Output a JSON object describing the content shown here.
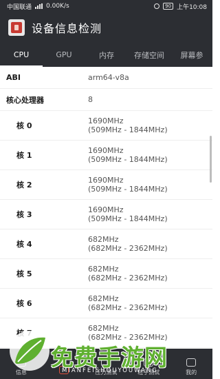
{
  "status_bar": {
    "carrier": "中国联通",
    "network_type": "4G",
    "speed": "0.00K/s",
    "battery": "90",
    "time": "上午10:08"
  },
  "app_bar": {
    "title": "设备信息检测"
  },
  "tabs": [
    {
      "label": "CPU",
      "active": true
    },
    {
      "label": "GPU",
      "active": false
    },
    {
      "label": "内存",
      "active": false
    },
    {
      "label": "存储空间",
      "active": false
    },
    {
      "label": "屏幕参",
      "active": false
    }
  ],
  "info_rows": [
    {
      "label": "ABI",
      "value": "arm64-v8a"
    },
    {
      "label": "核心处理器",
      "value": "8"
    }
  ],
  "cores": [
    {
      "label": "核 0",
      "freq": "1690MHz",
      "range": "(509MHz - 1844MHz)"
    },
    {
      "label": "核 1",
      "freq": "1690MHz",
      "range": "(509MHz - 1844MHz)"
    },
    {
      "label": "核 2",
      "freq": "1690MHz",
      "range": "(509MHz - 1844MHz)"
    },
    {
      "label": "核 3",
      "freq": "1690MHz",
      "range": "(509MHz - 1844MHz)"
    },
    {
      "label": "核 4",
      "freq": "682MHz",
      "range": "(682MHz - 2362MHz)"
    },
    {
      "label": "核 5",
      "freq": "682MHz",
      "range": "(682MHz - 2362MHz)"
    },
    {
      "label": "核 6",
      "freq": "682MHz",
      "range": "(682MHz - 2362MHz)"
    },
    {
      "label": "核 7",
      "freq": "682MHz",
      "range": "(682MHz - 2362MHz)"
    }
  ],
  "bottom_nav": [
    {
      "label": "信息",
      "icon": "info-icon",
      "active": false
    },
    {
      "label": "",
      "icon": "device-icon",
      "active": true
    },
    {
      "label": "压力测试",
      "icon": "pressure-icon",
      "active": false
    },
    {
      "label": "粒子测试",
      "icon": "particle-icon",
      "active": false
    },
    {
      "label": "我的",
      "icon": "profile-icon",
      "active": false
    }
  ],
  "watermark": {
    "text": "免费手游网",
    "sub": "MIANFEISHOUYOUWANG"
  },
  "colors": {
    "bar_bg": "#2c2e33",
    "accent": "#e0523e",
    "watermark": "#5fb030"
  }
}
